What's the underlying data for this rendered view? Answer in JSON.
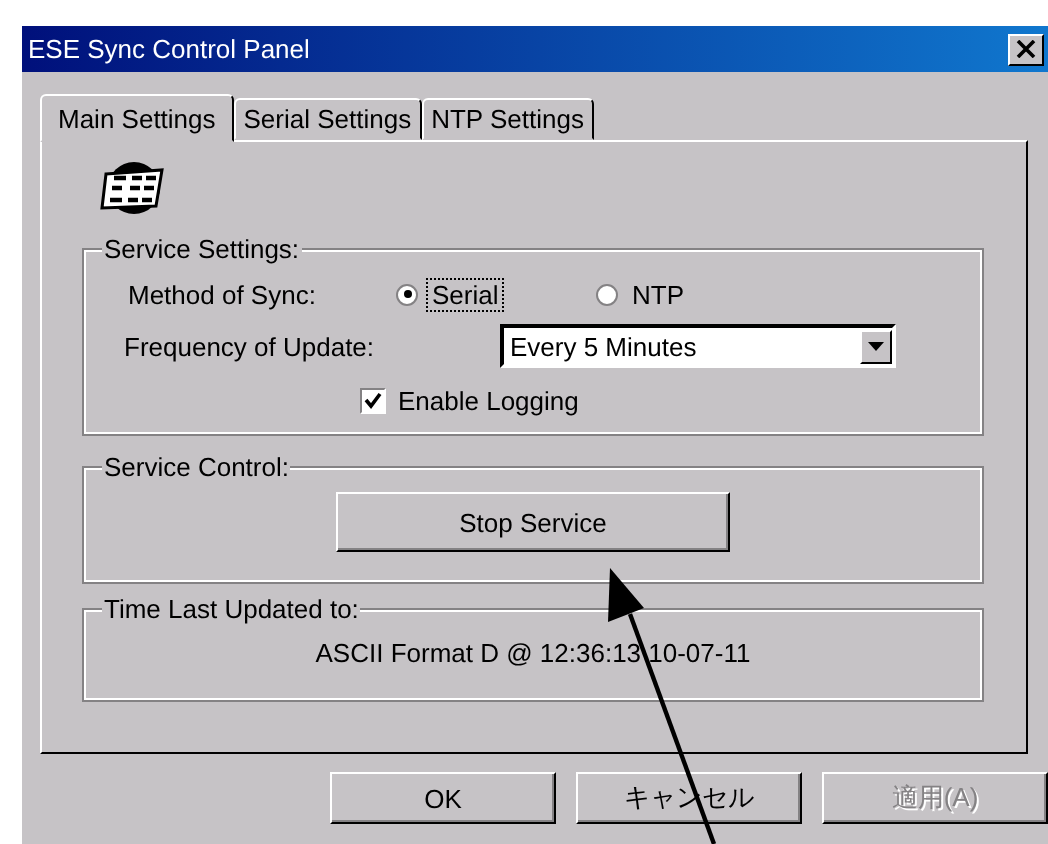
{
  "window": {
    "title": "ESE Sync Control Panel"
  },
  "tabs": [
    {
      "label": "Main Settings",
      "selected": true
    },
    {
      "label": "Serial Settings",
      "selected": false
    },
    {
      "label": "NTP Settings",
      "selected": false
    }
  ],
  "service_settings": {
    "label": "Service Settings:",
    "method_label": "Method of Sync:",
    "options": [
      {
        "label": "Serial",
        "selected": true,
        "focused": true
      },
      {
        "label": "NTP",
        "selected": false,
        "focused": false
      }
    ],
    "frequency_label": "Frequency of Update:",
    "frequency_value": "Every 5 Minutes",
    "logging": {
      "label": "Enable Logging",
      "checked": true
    }
  },
  "service_control": {
    "label": "Service Control:",
    "button": "Stop Service"
  },
  "time_last_updated": {
    "label": "Time Last Updated to:",
    "value": "ASCII Format D @ 12:36:13  10-07-11"
  },
  "buttons": [
    {
      "label": "OK",
      "disabled": false
    },
    {
      "label": "キャンセル",
      "disabled": false
    },
    {
      "label": "適用(A)",
      "disabled": true
    }
  ]
}
